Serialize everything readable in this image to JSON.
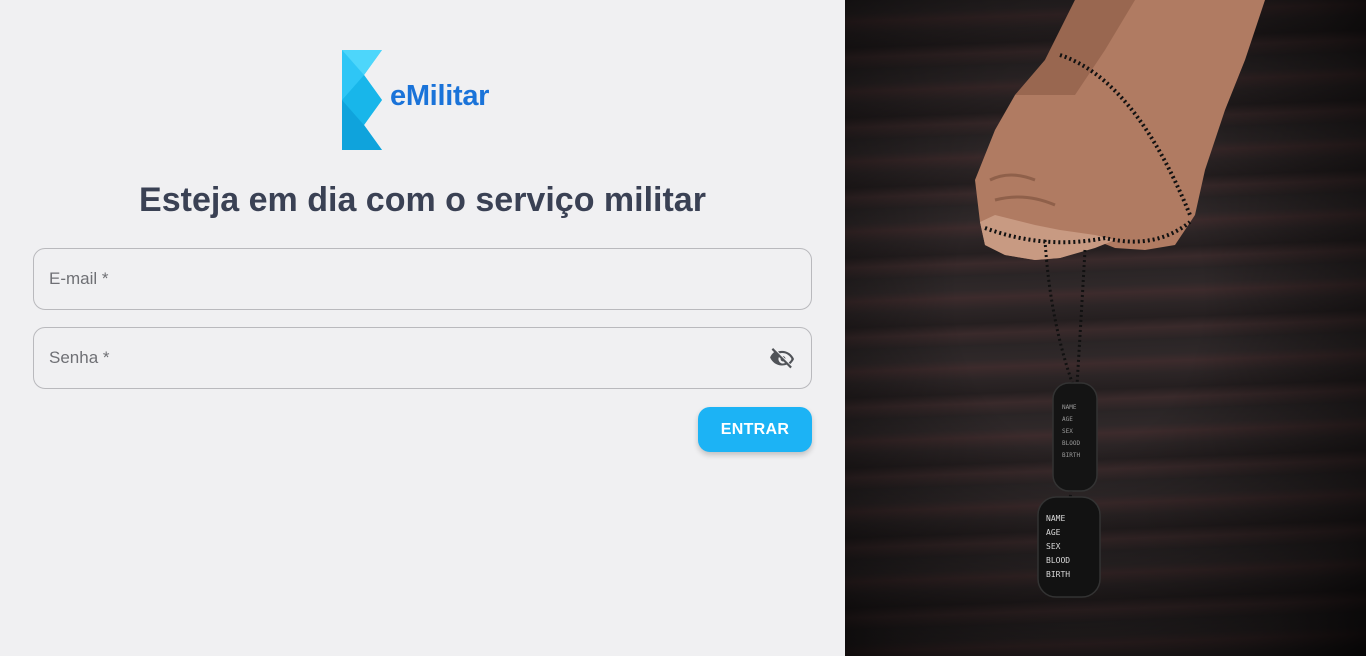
{
  "brand": {
    "name": "eMilitar",
    "colors": {
      "primary": "#1a73d9",
      "logo_light": "#22c7f5",
      "button": "#1cb3f5",
      "heading": "#3a4154"
    }
  },
  "login": {
    "headline": "Esteja em dia com o serviço militar",
    "email_label": "E-mail *",
    "password_label": "Senha *",
    "toggle_icon": "eye-off-icon",
    "submit_label": "ENTRAR"
  },
  "hero": {
    "image_subject": "dog-tags-photo",
    "tag_lines": [
      "NAME",
      "AGE",
      "SEX",
      "BLOOD",
      "BIRTH"
    ]
  }
}
